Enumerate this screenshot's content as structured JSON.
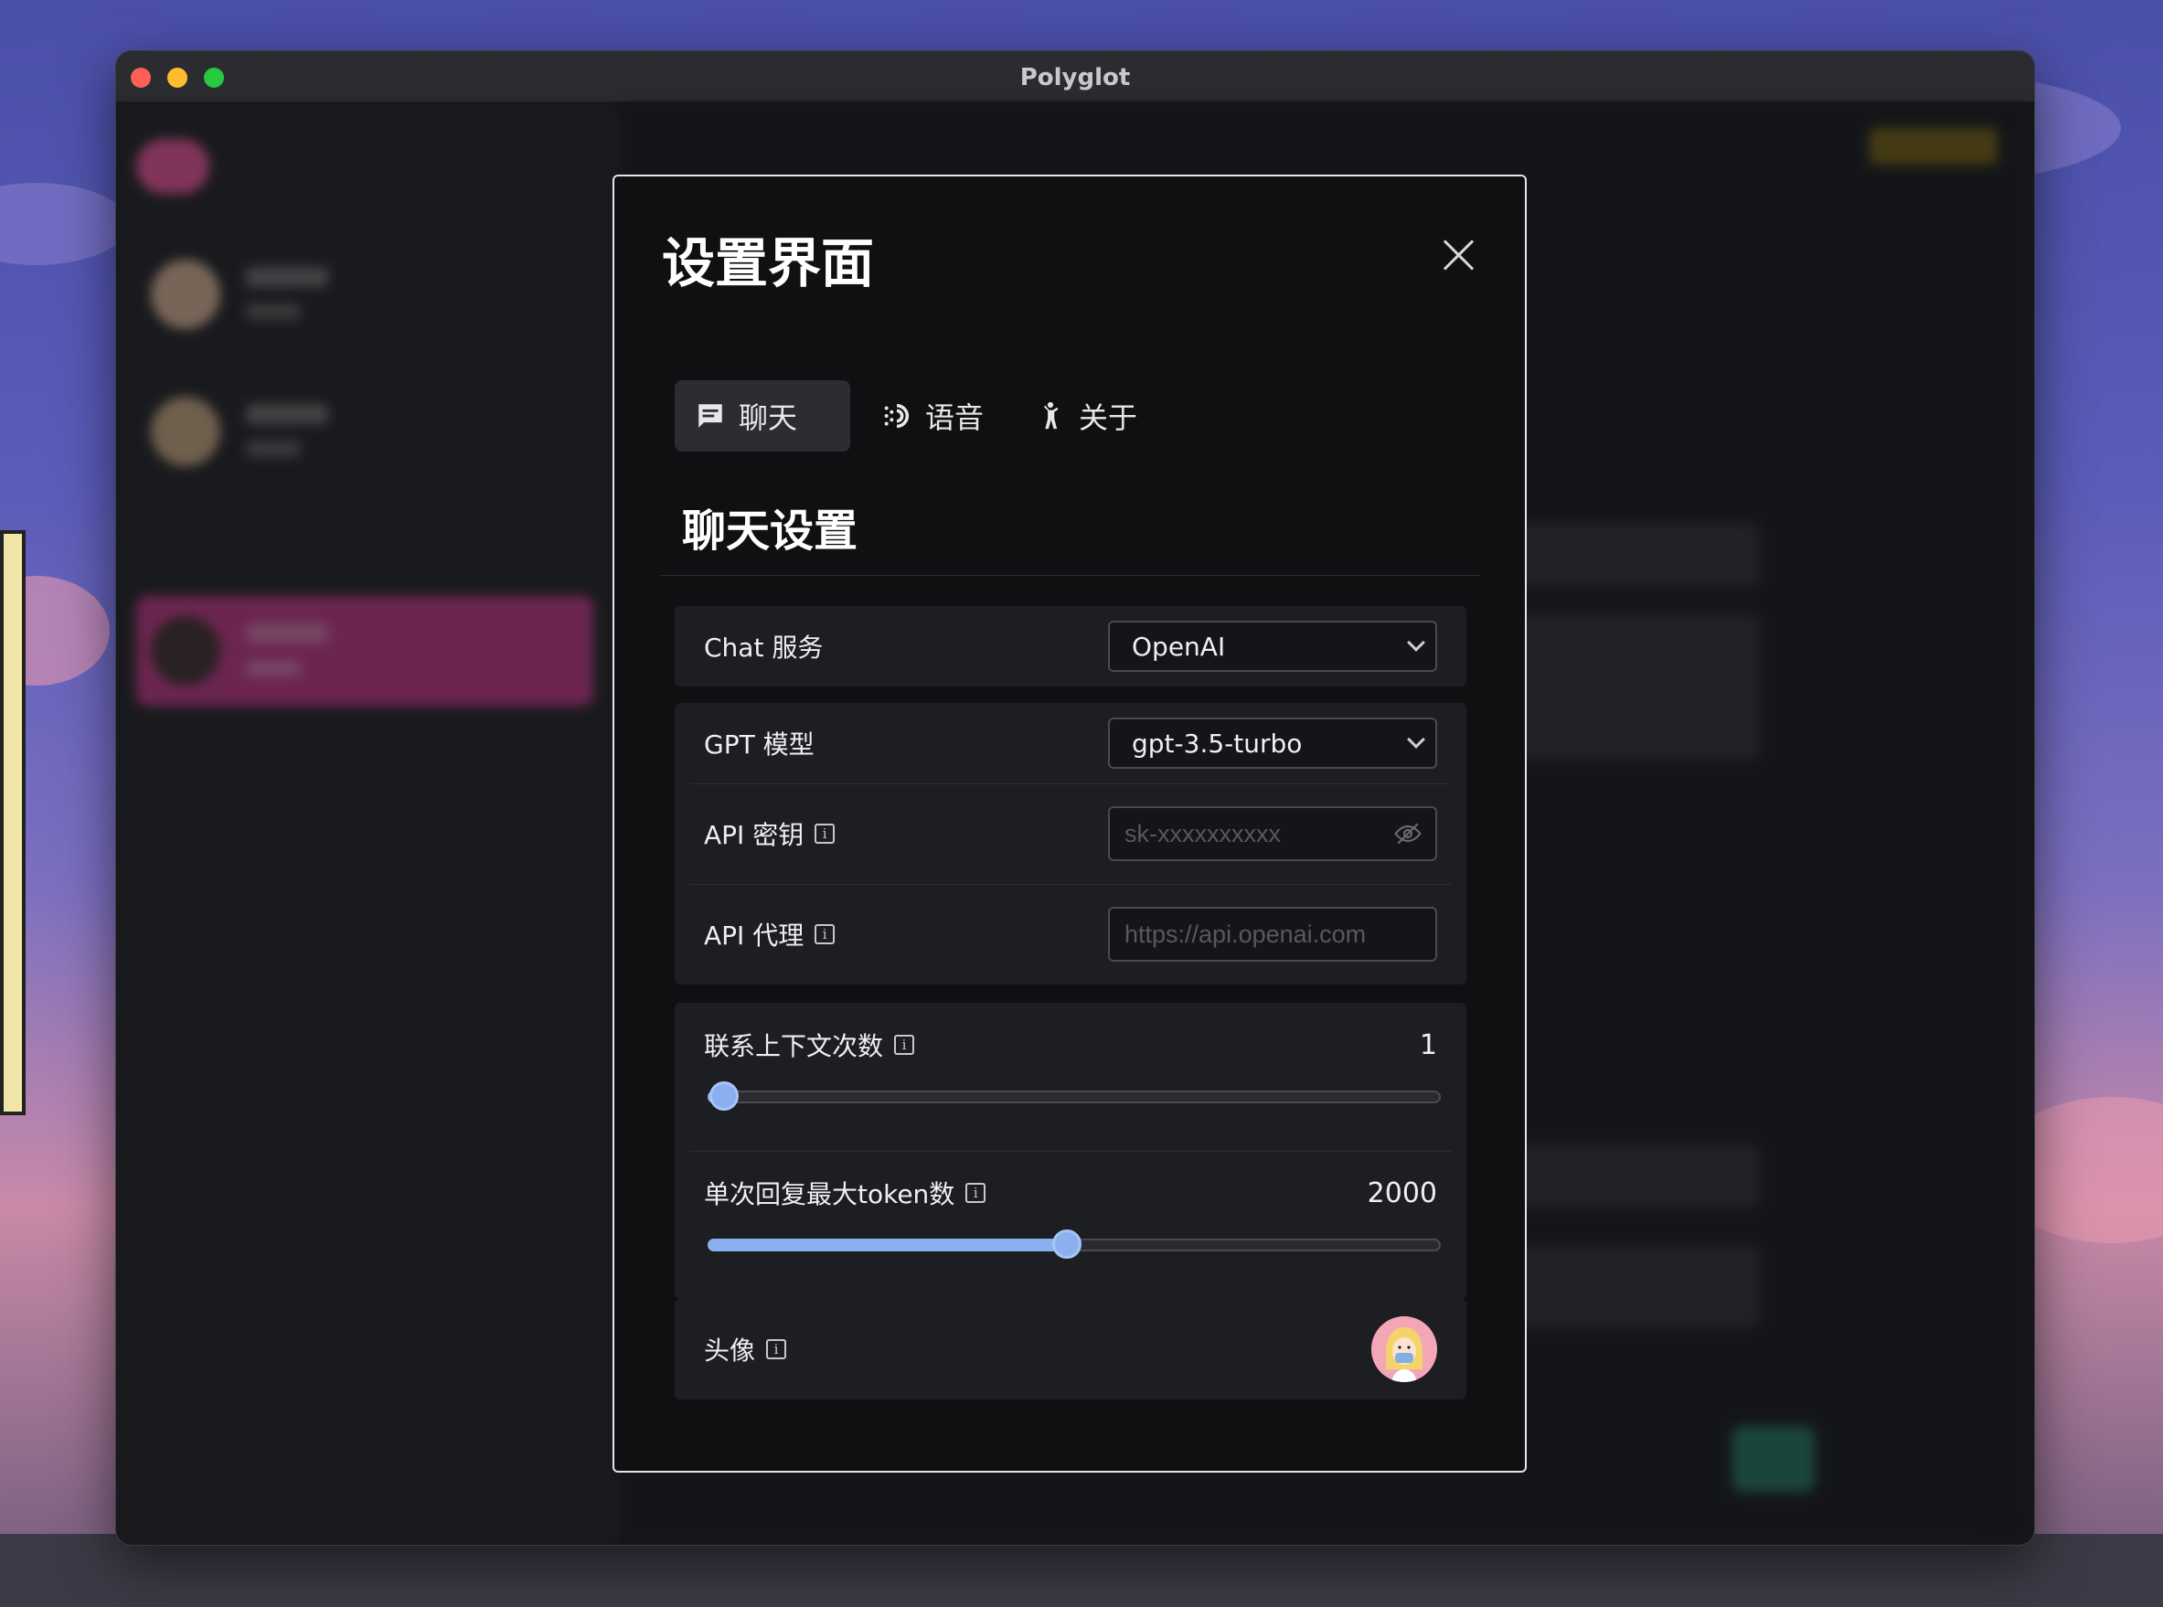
{
  "window": {
    "title": "Polyglot"
  },
  "modal": {
    "title": "设置界面",
    "tabs": [
      {
        "label": "聊天",
        "icon": "chat-icon"
      },
      {
        "label": "语音",
        "icon": "voice-icon"
      },
      {
        "label": "关于",
        "icon": "person-icon"
      }
    ],
    "section_title": "聊天设置",
    "chat_service": {
      "label": "Chat 服务",
      "value": "OpenAI"
    },
    "gpt_model": {
      "label": "GPT 模型",
      "value": "gpt-3.5-turbo"
    },
    "api_key": {
      "label": "API 密钥",
      "placeholder": "sk-xxxxxxxxxx"
    },
    "api_proxy": {
      "label": "API 代理",
      "placeholder": "https://api.openai.com"
    },
    "context_count": {
      "label": "联系上下文次数",
      "value": "1",
      "fraction": 0.02
    },
    "max_tokens": {
      "label": "单次回复最大token数",
      "value": "2000",
      "fraction": 0.49
    },
    "avatar": {
      "label": "头像"
    }
  },
  "colors": {
    "accent": "#8ab0f0",
    "modal_bg": "#0f1012",
    "card_bg": "#1d1e22",
    "active_chat": "#b1327b"
  }
}
